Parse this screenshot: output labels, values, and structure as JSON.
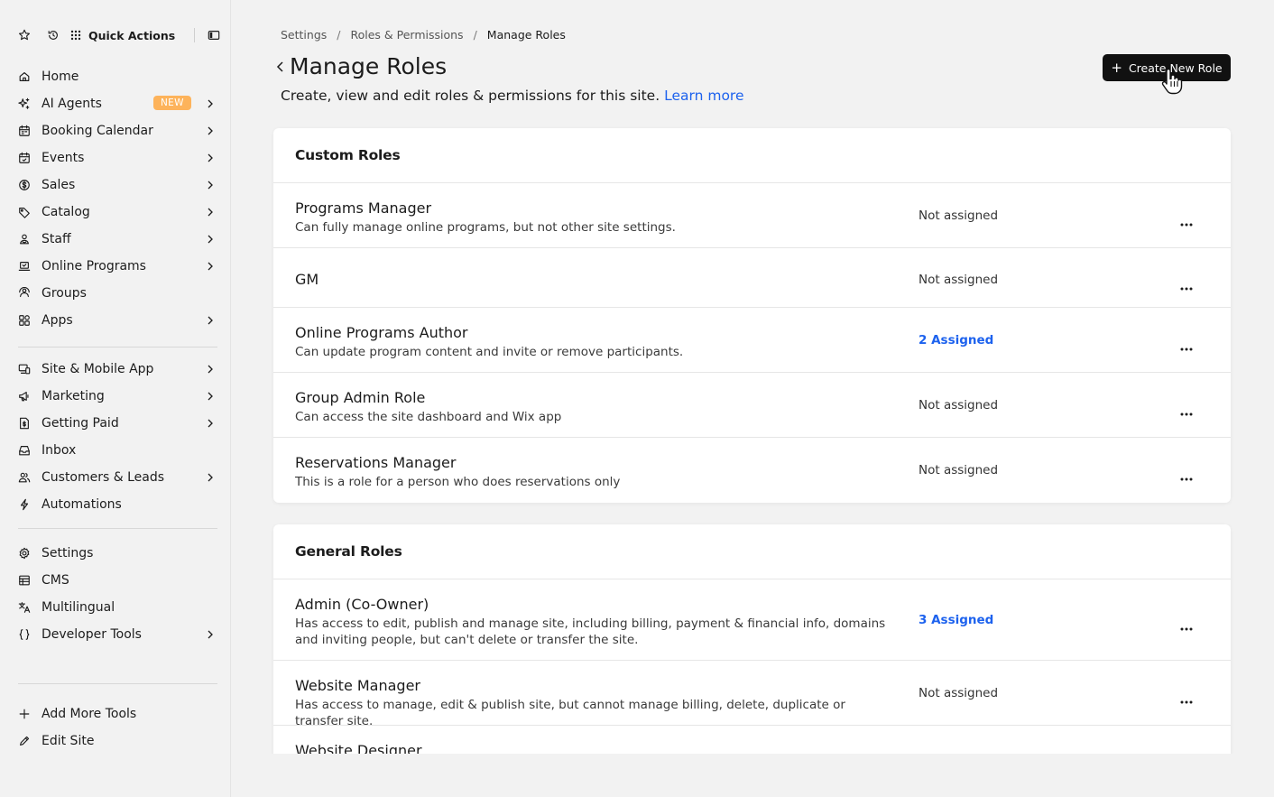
{
  "sidebar": {
    "quick_actions_label": "Quick Actions",
    "groups": [
      [
        {
          "label": "Home",
          "icon": "home-icon",
          "chevron": false
        },
        {
          "label": "AI Agents",
          "icon": "sparkle-icon",
          "chevron": true,
          "badge": "NEW"
        },
        {
          "label": "Booking Calendar",
          "icon": "calendar-icon",
          "chevron": true
        },
        {
          "label": "Events",
          "icon": "event-calendar-icon",
          "chevron": true
        },
        {
          "label": "Sales",
          "icon": "dollar-icon",
          "chevron": true
        },
        {
          "label": "Catalog",
          "icon": "tag-icon",
          "chevron": true
        },
        {
          "label": "Staff",
          "icon": "staff-icon",
          "chevron": true
        },
        {
          "label": "Online Programs",
          "icon": "laptop-icon",
          "chevron": true
        },
        {
          "label": "Groups",
          "icon": "groups-icon",
          "chevron": false
        },
        {
          "label": "Apps",
          "icon": "apps-icon",
          "chevron": true
        }
      ],
      [
        {
          "label": "Site & Mobile App",
          "icon": "devices-icon",
          "chevron": true
        },
        {
          "label": "Marketing",
          "icon": "megaphone-icon",
          "chevron": true
        },
        {
          "label": "Getting Paid",
          "icon": "invoice-icon",
          "chevron": true
        },
        {
          "label": "Inbox",
          "icon": "inbox-icon",
          "chevron": false
        },
        {
          "label": "Customers & Leads",
          "icon": "customers-icon",
          "chevron": true
        },
        {
          "label": "Automations",
          "icon": "lightning-icon",
          "chevron": false
        }
      ],
      [
        {
          "label": "Settings",
          "icon": "gear-icon",
          "chevron": false
        },
        {
          "label": "CMS",
          "icon": "table-icon",
          "chevron": false
        },
        {
          "label": "Multilingual",
          "icon": "translate-icon",
          "chevron": false
        },
        {
          "label": "Developer Tools",
          "icon": "braces-icon",
          "chevron": true
        }
      ],
      [
        {
          "label": "Add More Tools",
          "icon": "plus-icon",
          "chevron": false
        },
        {
          "label": "Edit Site",
          "icon": "pencil-icon",
          "chevron": false
        }
      ]
    ]
  },
  "breadcrumb": [
    "Settings",
    "Roles & Permissions",
    "Manage Roles"
  ],
  "page": {
    "title": "Manage Roles",
    "subtitle": "Create, view and edit roles & permissions for this site.",
    "learn_more": "Learn more",
    "create_button": "Create New Role"
  },
  "sections": [
    {
      "heading": "Custom Roles",
      "rows": [
        {
          "name": "Programs Manager",
          "desc": "Can fully manage online programs, but not other site settings.",
          "status": "Not assigned",
          "assigned": false
        },
        {
          "name": "GM",
          "desc": "",
          "status": "Not assigned",
          "assigned": false
        },
        {
          "name": "Online Programs Author",
          "desc": "Can update program content and invite or remove participants.",
          "status": "2 Assigned",
          "assigned": true
        },
        {
          "name": "Group Admin Role",
          "desc": "Can access the site dashboard and Wix app",
          "status": "Not assigned",
          "assigned": false
        },
        {
          "name": "Reservations Manager",
          "desc": "This is a role for a person who does reservations only",
          "status": "Not assigned",
          "assigned": false
        }
      ]
    },
    {
      "heading": "General Roles",
      "rows": [
        {
          "name": "Admin (Co-Owner)",
          "desc": "Has access to edit, publish and manage site, including billing, payment & financial info, domains and inviting people, but can't delete or transfer the site.",
          "status": "3 Assigned",
          "assigned": true
        },
        {
          "name": "Website Manager",
          "desc": "Has access to manage, edit & publish site, but cannot manage billing, delete, duplicate or transfer site.",
          "status": "Not assigned",
          "assigned": false
        },
        {
          "name": "Website Designer",
          "desc": "",
          "status": "",
          "assigned": false
        }
      ]
    }
  ],
  "colors": {
    "accent_link": "#1d62ee",
    "badge": "#fdb35b",
    "cta_bg": "#111111"
  }
}
